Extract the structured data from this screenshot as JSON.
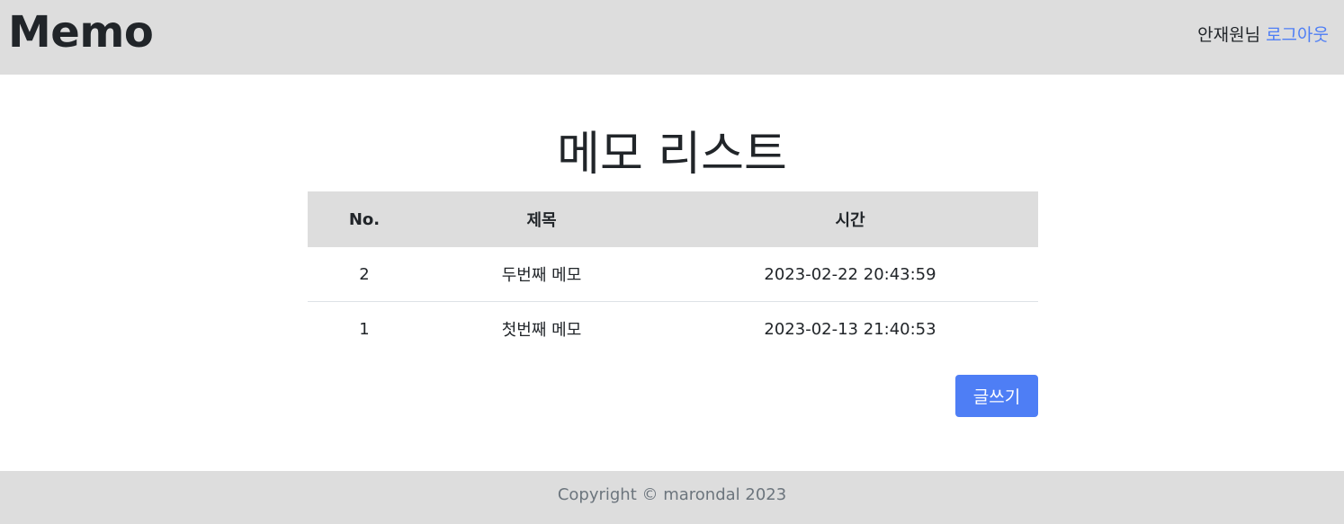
{
  "header": {
    "logo": "Memo",
    "user_greeting": "안재원님",
    "logout_label": "로그아웃"
  },
  "main": {
    "title": "메모 리스트",
    "table": {
      "columns": [
        "No.",
        "제목",
        "시간"
      ],
      "rows": [
        {
          "no": "2",
          "title": "두번째 메모",
          "time": "2023-02-22 20:43:59"
        },
        {
          "no": "1",
          "title": "첫번째 메모",
          "time": "2023-02-13 21:40:53"
        }
      ]
    },
    "write_button_label": "글쓰기"
  },
  "footer": {
    "copyright": "Copyright © marondal 2023"
  },
  "colors": {
    "header_bg": "#dddddd",
    "accent": "#4e7ef5",
    "footer_text": "#6c757d"
  }
}
